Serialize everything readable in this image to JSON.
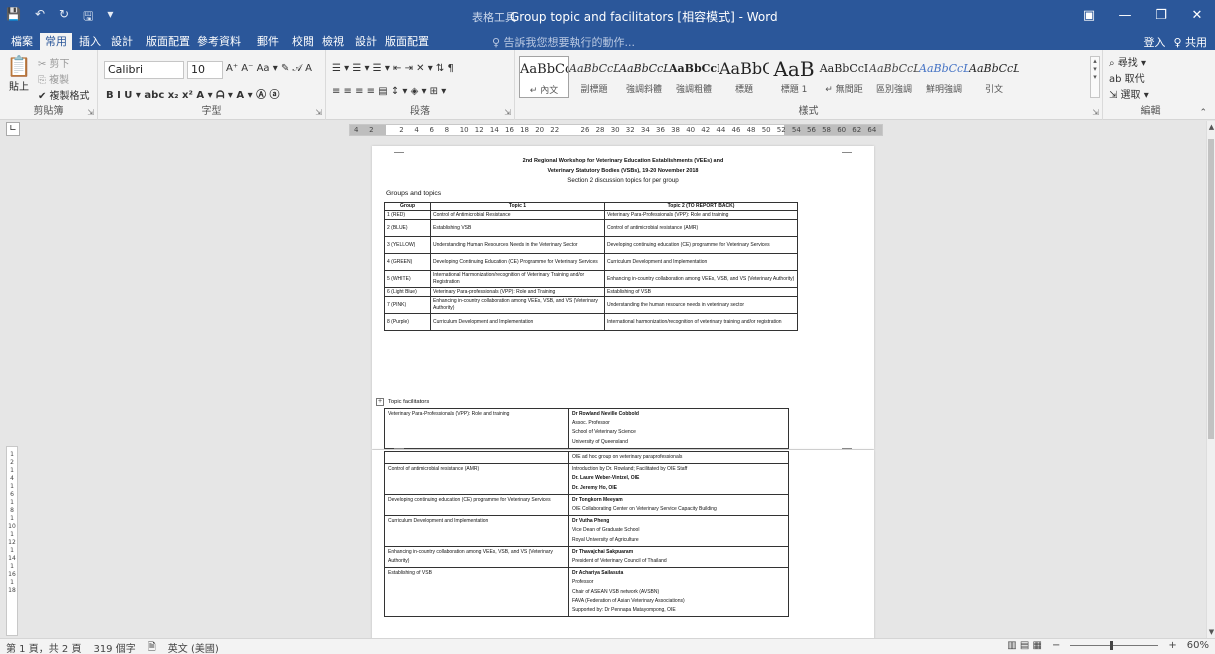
{
  "window": {
    "title": "Group topic and facilitators [相容模式] - Word",
    "context_label": "表格工具",
    "qat": [
      "💾",
      "↶",
      "↻",
      "🖫",
      "▾"
    ],
    "controls": [
      "▣",
      "—",
      "❐",
      "✕"
    ]
  },
  "tabs": {
    "items": [
      "檔案",
      "常用",
      "插入",
      "設計",
      "版面配置",
      "參考資料",
      "郵件",
      "校閱",
      "檢視",
      "設計",
      "版面配置"
    ],
    "active": "常用",
    "tell_me": "♀ 告訴我您想要執行的動作...",
    "signin": "登入",
    "share": "♀ 共用"
  },
  "ribbon": {
    "clipboard": {
      "label": "剪貼簿",
      "paste": "貼上",
      "cut": "✂ 剪下",
      "copy": "⎘ 複製",
      "format_painter": "✔ 複製格式"
    },
    "font": {
      "label": "字型",
      "name": "Calibri",
      "size": "10",
      "row1_icons": "A⁺ A⁻ Aa ▾ ✎ 𝒜 A",
      "row2_icons": "B  I  U ▾ abc x₂ x² A ▾ ᗩ ▾ A ▾ Ⓐ ⓐ"
    },
    "paragraph": {
      "label": "段落",
      "row1_icons": "☰ ▾ ☰ ▾ ☰ ▾  ⇤ ⇥  ✕ ▾  ⇅  ¶",
      "row2_icons": "≡ ≡ ≡ ≡ ▤  ↕ ▾  ◈ ▾  ⊞ ▾"
    },
    "styles": {
      "label": "樣式",
      "items": [
        {
          "sample": "AaBbCcI",
          "name": "↵ 內文"
        },
        {
          "sample": "AaBbCcD",
          "name": "副標題"
        },
        {
          "sample": "AaBbCcL",
          "name": "強調斜體"
        },
        {
          "sample": "AaBbCcI",
          "name": "強調粗體"
        },
        {
          "sample": "AaBbC",
          "name": "標題"
        },
        {
          "sample": "AaB",
          "name": "標題 1"
        },
        {
          "sample": "AaBbCcI",
          "name": "↵ 無間距"
        },
        {
          "sample": "AaBbCcL",
          "name": "區別強調"
        },
        {
          "sample": "AaBbCcL",
          "name": "鮮明強調"
        },
        {
          "sample": "AaBbCcL",
          "name": "引文"
        }
      ]
    },
    "editing": {
      "label": "編輯",
      "find": "⌕ 尋找 ▾",
      "replace": "ab 取代",
      "select": "⇲ 選取 ▾"
    }
  },
  "ruler": {
    "numbers": [
      "4",
      "2",
      "",
      "2",
      "4",
      "6",
      "8",
      "10",
      "12",
      "14",
      "16",
      "18",
      "20",
      "22",
      "",
      "26",
      "28",
      "30",
      "32",
      "34",
      "36",
      "38",
      "40",
      "42",
      "44",
      "46",
      "48",
      "50",
      "52",
      "54",
      "56",
      "58",
      "60",
      "62",
      "64"
    ]
  },
  "document": {
    "header_line1": "2nd Regional Workshop for Veterinary Education Establishments (VEEs) and",
    "header_line2": "Veterinary Statutory Bodies (VSBs), 19-20 November 2018",
    "header_line3": "Section 2 discussion topics for per group",
    "groups_heading": "Groups and topics",
    "table_headers": [
      "Group",
      "Topic 1",
      "Topic 2 (TO REPORT BACK)"
    ],
    "table_rows": [
      [
        "1 (RED)",
        "Control of Antimicrobial Resistance",
        "Veterinary Para-Professionals (VPP): Role and training"
      ],
      [
        "2 (BLUE)",
        "Establishing VSB",
        "Control of antimicrobial resistance (AMR)"
      ],
      [
        "3 (YELLOW)",
        "Understanding Human Resources Needs in the Veterinary Sector",
        "Developing continuing education (CE) programme for Veterinary Services"
      ],
      [
        "4 (GREEN)",
        "Developing Continuing Education (CE) Programme for Veterinary Services",
        "Curriculum Development and Implementation"
      ],
      [
        "5 (WHITE)",
        "International Harmonization/recognition of Veterinary Training and/or Registration",
        "Enhancing in-country collaboration among VEEs, VSB, and VS (Veterinary Authority)"
      ],
      [
        "6 (Light Blue)",
        "Veterinary Para-professionals (VPP): Role and Training",
        "Establishing of VSB"
      ],
      [
        "7 (PINK)",
        "Enhancing in-country collaboration among VEEs, VSB, and VS (Veterinary Authority)",
        "Understanding the human resource needs in veterinary sector"
      ],
      [
        "8 (Purple)",
        "Curriculum Development and Implementation",
        "International harmonization/recognition of veterinary training and/or registration"
      ]
    ],
    "facilitators_heading": "Topic facilitators",
    "facil_page1": {
      "topic": "Veterinary Para-Professionals (VPP): Role and training",
      "lines": [
        "Dr Rowland Neville Cobbold",
        "Assoc. Professor",
        "School of Veterinary Science",
        "University of Queensland"
      ]
    },
    "facil_page2": [
      {
        "topic": "",
        "lines": [
          "OIE ad hoc group on veterinary paraprofessionals"
        ]
      },
      {
        "topic": "Control of antimicrobial resistance (AMR)",
        "lines": [
          "Introduction by Dr. Rowland; Facilitated by OIE Staff",
          "Dr. Laure Weber-Vintzel, OIE",
          "Dr. Jeremy Ho, OIE"
        ]
      },
      {
        "topic": "Developing continuing education (CE) programme for Veterinary Services",
        "lines": [
          "Dr Tongkorn Meeyam",
          "OIE Collaborating Center on Veterinary Service Capacity Building"
        ]
      },
      {
        "topic": "Curriculum Development and Implementation",
        "lines": [
          "Dr Vutha Pheng",
          "Vice Dean of Graduate School",
          "Royal University of Agriculture"
        ]
      },
      {
        "topic": "Enhancing in-country collaboration among VEEs, VSB, and VS (Veterinary Authority)",
        "lines": [
          "Dr Thavajchai Sakpuaram",
          "President of Veterinary Council of Thailand"
        ]
      },
      {
        "topic": "Establishing of VSB",
        "lines": [
          "Dr Achariya Sailasuta",
          "Professor",
          "Chair of ASEAN VSB network (AVSBN)",
          "FAVA (Federation of Asian Veterinary Associations)",
          "Supported by: Dr Pennapa Matayompong, OIE"
        ]
      }
    ]
  },
  "statusbar": {
    "page": "第 1 頁，共 2 頁",
    "words": "319 個字",
    "proof_icon": "🗎",
    "language": "英文 (美國)",
    "view_icons": "▥  ▤  ▦",
    "zoom_minus": "−",
    "zoom_plus": "+",
    "zoom": "60%"
  }
}
